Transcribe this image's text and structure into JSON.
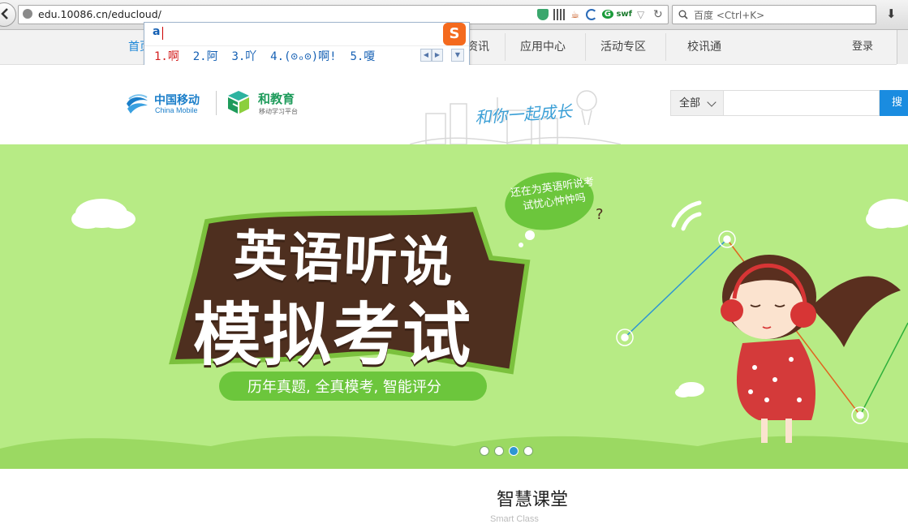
{
  "browser": {
    "url": "edu.10086.cn/educloud/",
    "search_placeholder": "百度 <Ctrl+K>",
    "addon_icons": [
      "shield-icon",
      "qr-icon",
      "java-icon",
      "crescent-icon",
      "swf-icon",
      "star-icon",
      "refresh-icon"
    ],
    "addon_swf_label": "swf"
  },
  "ime": {
    "input": "a",
    "candidates": [
      "1.啊",
      "2.阿",
      "3.吖",
      "4.(⊙ₒ⊙)啊!",
      "5.嗄"
    ],
    "logo": "S"
  },
  "nav": {
    "home": "首页",
    "items": [
      "资讯",
      "应用中心",
      "活动专区",
      "校讯通"
    ],
    "login": "登录"
  },
  "header": {
    "cm_name": "中国移动",
    "cm_name_en": "China Mobile",
    "he_name": "和教育",
    "he_sub": "移动学习平台",
    "slogan": "和你一起成长",
    "search_category": "全部",
    "search_button": "搜索"
  },
  "banner": {
    "title_line1": "英语听说",
    "title_line2": "模拟考试",
    "subtitle": "历年真题, 全真模考, 智能评分",
    "bubble": "还在为英语听说考试忧心忡忡吗",
    "slides_total": 4,
    "active_slide": 3
  },
  "section": {
    "title": "智慧课堂",
    "subtitle": "Smart Class"
  },
  "colors": {
    "accent": "#1a8ce0",
    "banner_bg": "#b7eb85",
    "brand_green": "#1e9b5b"
  }
}
